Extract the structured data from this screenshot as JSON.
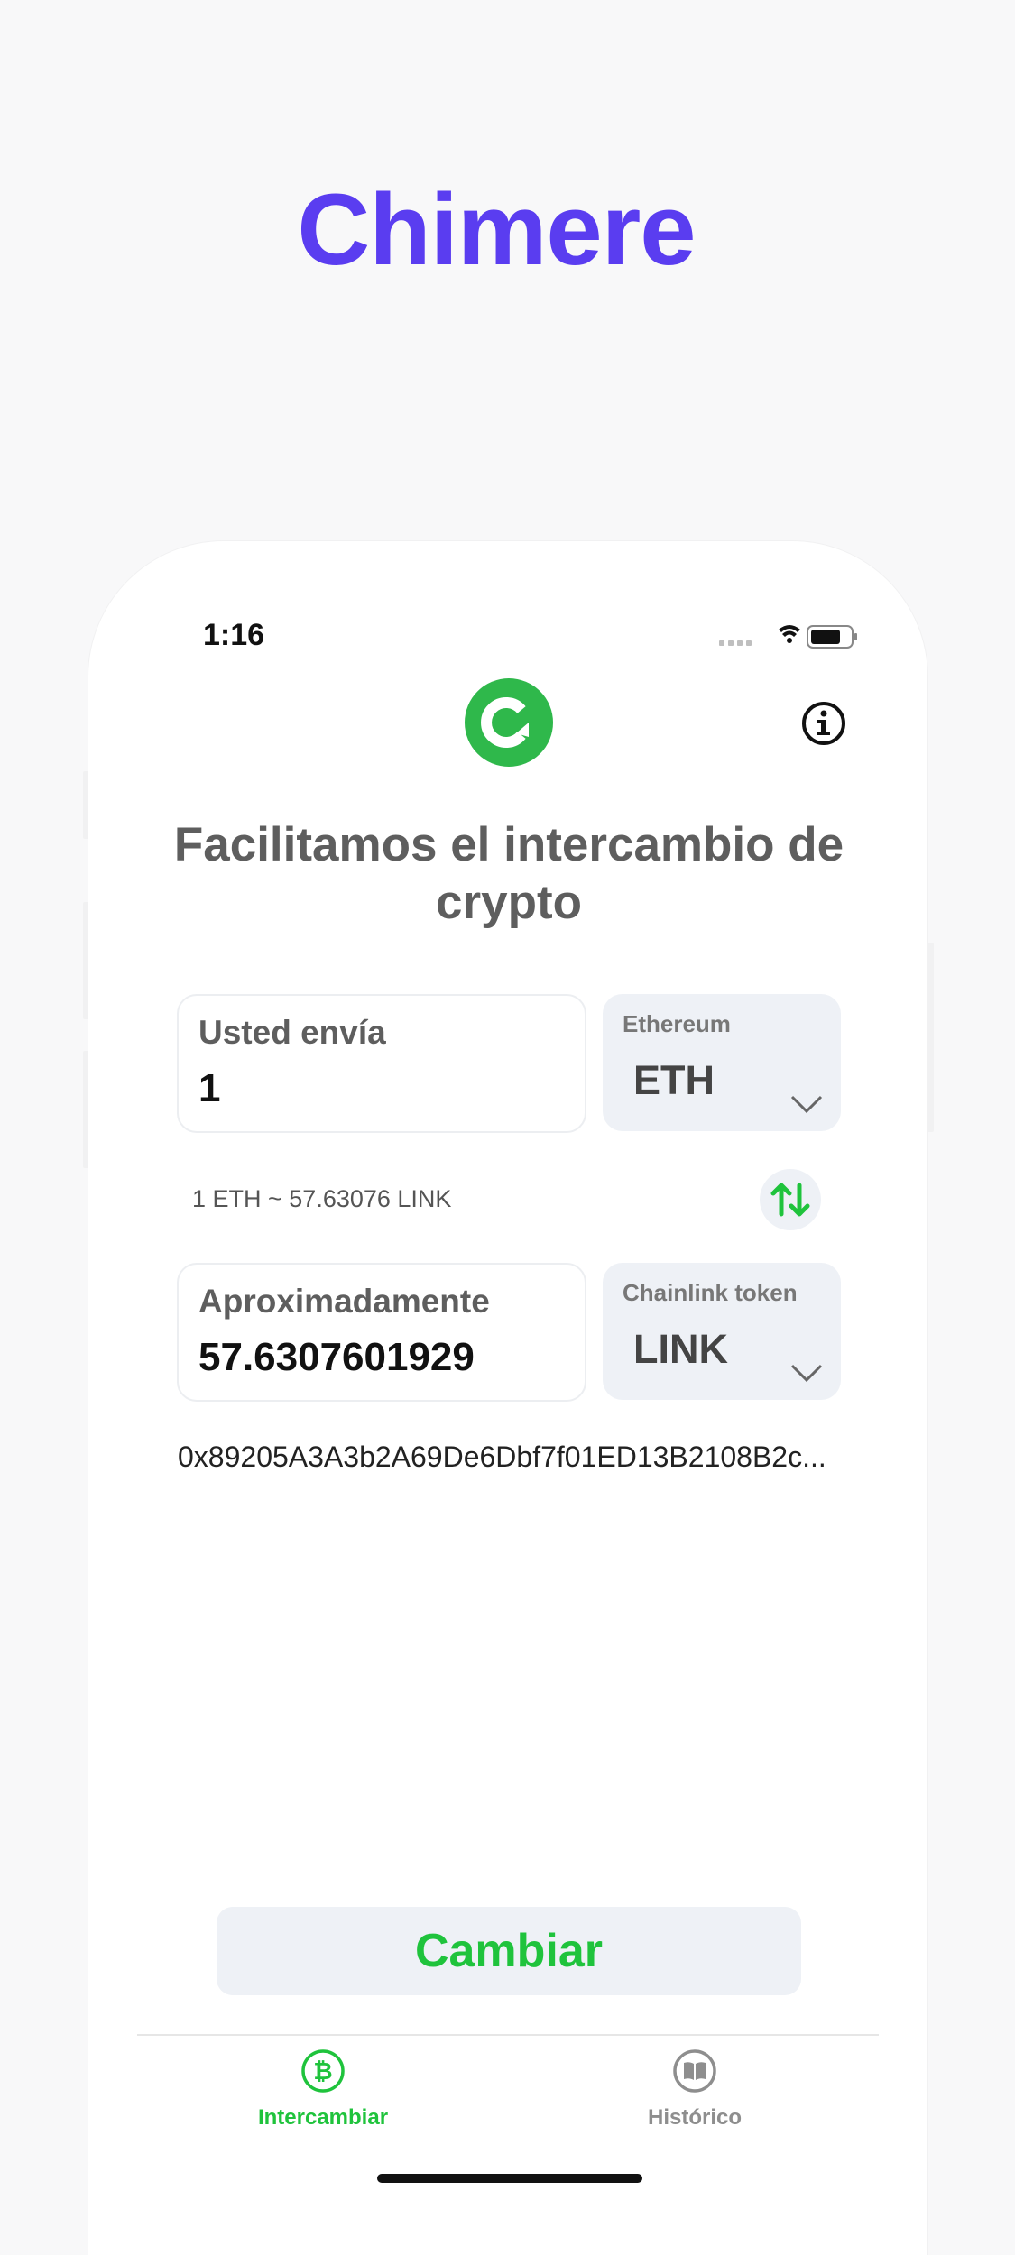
{
  "brand": {
    "title": "Chimere",
    "color": "#5a3df0"
  },
  "status_bar": {
    "time": "1:16"
  },
  "header": {
    "headline": "Facilitamos el intercambio de crypto"
  },
  "send": {
    "label": "Usted envía",
    "value": "1",
    "token_name": "Ethereum",
    "token_symbol": "ETH"
  },
  "rate": {
    "text": "1 ETH ~ 57.63076 LINK"
  },
  "receive": {
    "label": "Aproximadamente",
    "value": "57.6307601929",
    "token_name": "Chainlink token",
    "token_symbol": "LINK"
  },
  "address": {
    "text": "0x89205A3A3b2A69De6Dbf7f01ED13B2108B2c..."
  },
  "actions": {
    "swap_label": "Cambiar"
  },
  "tabs": [
    {
      "label": "Intercambiar",
      "icon": "bitcoin-circle-icon",
      "active": true
    },
    {
      "label": "Histórico",
      "icon": "book-icon",
      "active": false
    }
  ],
  "colors": {
    "accent": "#1fc33c",
    "logo": "#2fb84b",
    "inactive": "#8e8e8e"
  }
}
